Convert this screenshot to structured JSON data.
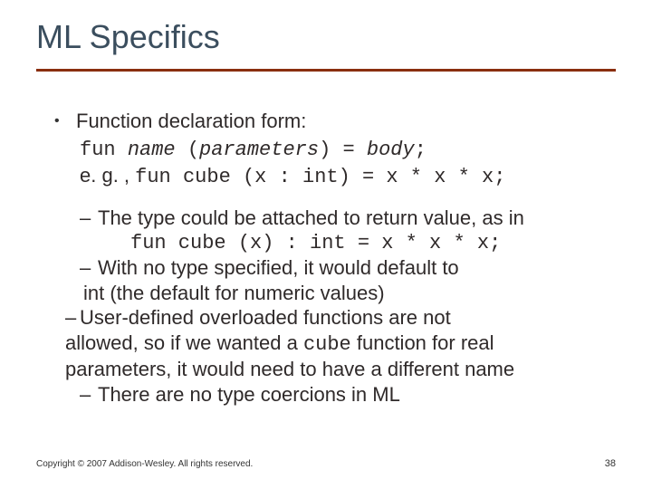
{
  "title": "ML Specifics",
  "main": {
    "heading": "Function declaration form:",
    "formprefix": "fun ",
    "formname": "name",
    "formparen": " (",
    "formparams": "parameters",
    "formmid": ") = ",
    "formbody": "body",
    "formend": ";",
    "egprefix": "e. g. , ",
    "egcode": "fun cube (x : int) = x * x * x;"
  },
  "subs": {
    "s1": "The type could be attached to return value, as in",
    "s1code": "fun cube (x) : int = x * x * x;",
    "s2a": "With no type specified, it would default to",
    "s2b": "int (the default for numeric values)",
    "s3a": "User-defined overloaded functions are not",
    "s3b_pre": "allowed, so if we wanted a ",
    "s3b_code": "cube",
    "s3b_post": " function for real",
    "s3c": "parameters, it would need to have a different name",
    "s4": "There are no type coercions in ML"
  },
  "footer": "Copyright © 2007 Addison-Wesley. All rights reserved.",
  "page": "38"
}
